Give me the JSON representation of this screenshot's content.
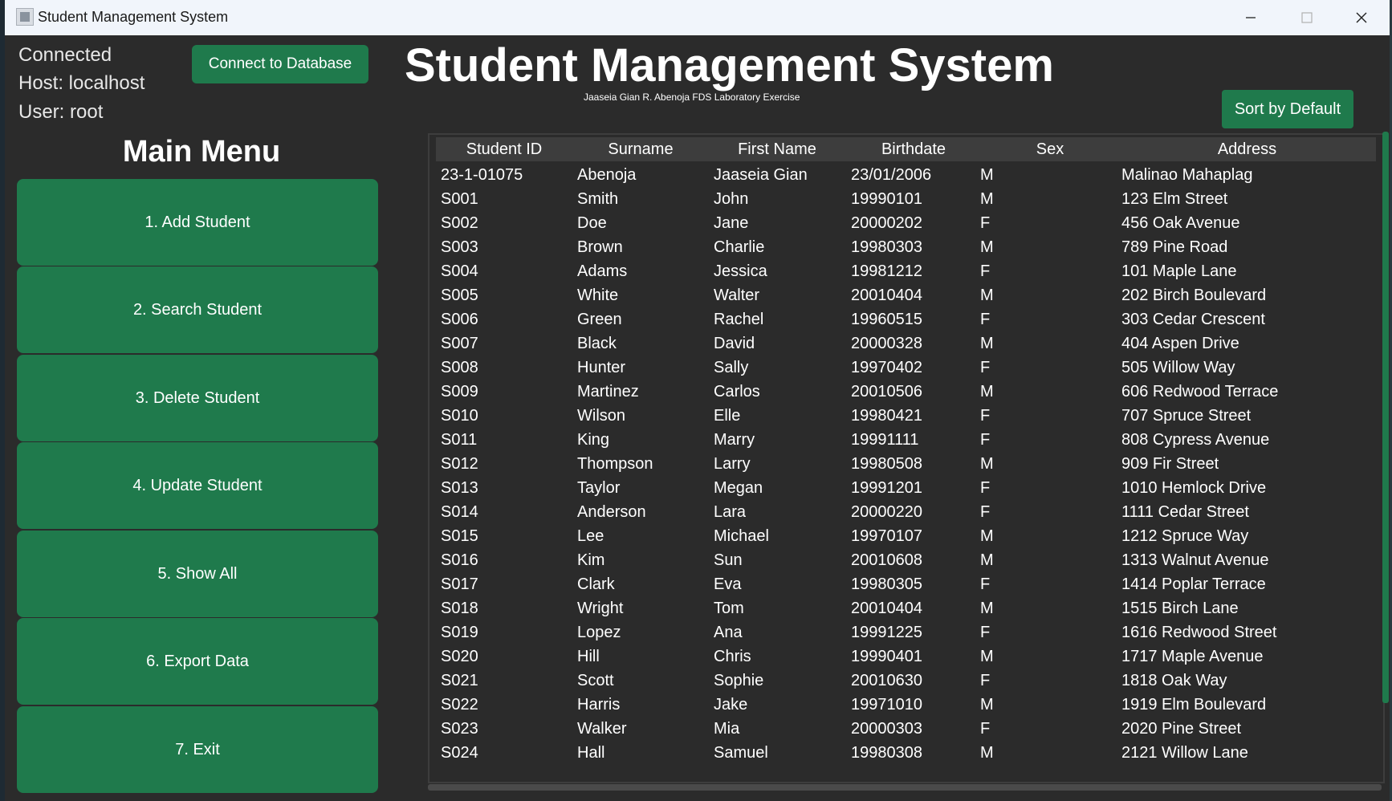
{
  "window": {
    "title": "Student Management System"
  },
  "status": {
    "connected": "Connected",
    "host": "Host: localhost",
    "user": "User: root"
  },
  "buttons": {
    "connect": "Connect to Database",
    "sort": "Sort by Default"
  },
  "header": {
    "title": "Student Management System",
    "subtitle": "Jaaseia Gian R. Abenoja FDS Laboratory Exercise"
  },
  "menu": {
    "title": "Main Menu",
    "items": [
      "1. Add Student",
      "2. Search Student",
      "3. Delete Student",
      "4. Update Student",
      "5. Show All",
      "6. Export Data",
      "7. Exit"
    ]
  },
  "table": {
    "columns": [
      "Student ID",
      "Surname",
      "First Name",
      "Birthdate",
      "Sex",
      "Address"
    ],
    "rows": [
      [
        "23-1-01075",
        "Abenoja",
        "Jaaseia Gian",
        "23/01/2006",
        "M",
        "Malinao Mahaplag"
      ],
      [
        "S001",
        "Smith",
        "John",
        "19990101",
        "M",
        "123 Elm Street"
      ],
      [
        "S002",
        "Doe",
        "Jane",
        "20000202",
        "F",
        "456 Oak Avenue"
      ],
      [
        "S003",
        "Brown",
        "Charlie",
        "19980303",
        "M",
        "789 Pine Road"
      ],
      [
        "S004",
        "Adams",
        "Jessica",
        "19981212",
        "F",
        "101 Maple Lane"
      ],
      [
        "S005",
        "White",
        "Walter",
        "20010404",
        "M",
        "202 Birch Boulevard"
      ],
      [
        "S006",
        "Green",
        "Rachel",
        "19960515",
        "F",
        "303 Cedar Crescent"
      ],
      [
        "S007",
        "Black",
        "David",
        "20000328",
        "M",
        "404 Aspen Drive"
      ],
      [
        "S008",
        "Hunter",
        "Sally",
        "19970402",
        "F",
        "505 Willow Way"
      ],
      [
        "S009",
        "Martinez",
        "Carlos",
        "20010506",
        "M",
        "606 Redwood Terrace"
      ],
      [
        "S010",
        "Wilson",
        "Elle",
        "19980421",
        "F",
        "707 Spruce Street"
      ],
      [
        "S011",
        "King",
        "Marry",
        "19991111",
        "F",
        "808 Cypress Avenue"
      ],
      [
        "S012",
        "Thompson",
        "Larry",
        "19980508",
        "M",
        "909 Fir Street"
      ],
      [
        "S013",
        "Taylor",
        "Megan",
        "19991201",
        "F",
        "1010 Hemlock Drive"
      ],
      [
        "S014",
        "Anderson",
        "Lara",
        "20000220",
        "F",
        "1111 Cedar Street"
      ],
      [
        "S015",
        "Lee",
        "Michael",
        "19970107",
        "M",
        "1212 Spruce Way"
      ],
      [
        "S016",
        "Kim",
        "Sun",
        "20010608",
        "M",
        "1313 Walnut Avenue"
      ],
      [
        "S017",
        "Clark",
        "Eva",
        "19980305",
        "F",
        "1414 Poplar Terrace"
      ],
      [
        "S018",
        "Wright",
        "Tom",
        "20010404",
        "M",
        "1515 Birch Lane"
      ],
      [
        "S019",
        "Lopez",
        "Ana",
        "19991225",
        "F",
        "1616 Redwood Street"
      ],
      [
        "S020",
        "Hill",
        "Chris",
        "19990401",
        "M",
        "1717 Maple Avenue"
      ],
      [
        "S021",
        "Scott",
        "Sophie",
        "20010630",
        "F",
        "1818 Oak Way"
      ],
      [
        "S022",
        "Harris",
        "Jake",
        "19971010",
        "M",
        "1919 Elm Boulevard"
      ],
      [
        "S023",
        "Walker",
        "Mia",
        "20000303",
        "F",
        "2020 Pine Street"
      ],
      [
        "S024",
        "Hall",
        "Samuel",
        "19980308",
        "M",
        "2121 Willow Lane"
      ]
    ]
  },
  "colors": {
    "accent": "#1f7a4c",
    "background": "#2b2b2b",
    "header_row": "#3d3d3d",
    "text": "#ffffff"
  }
}
